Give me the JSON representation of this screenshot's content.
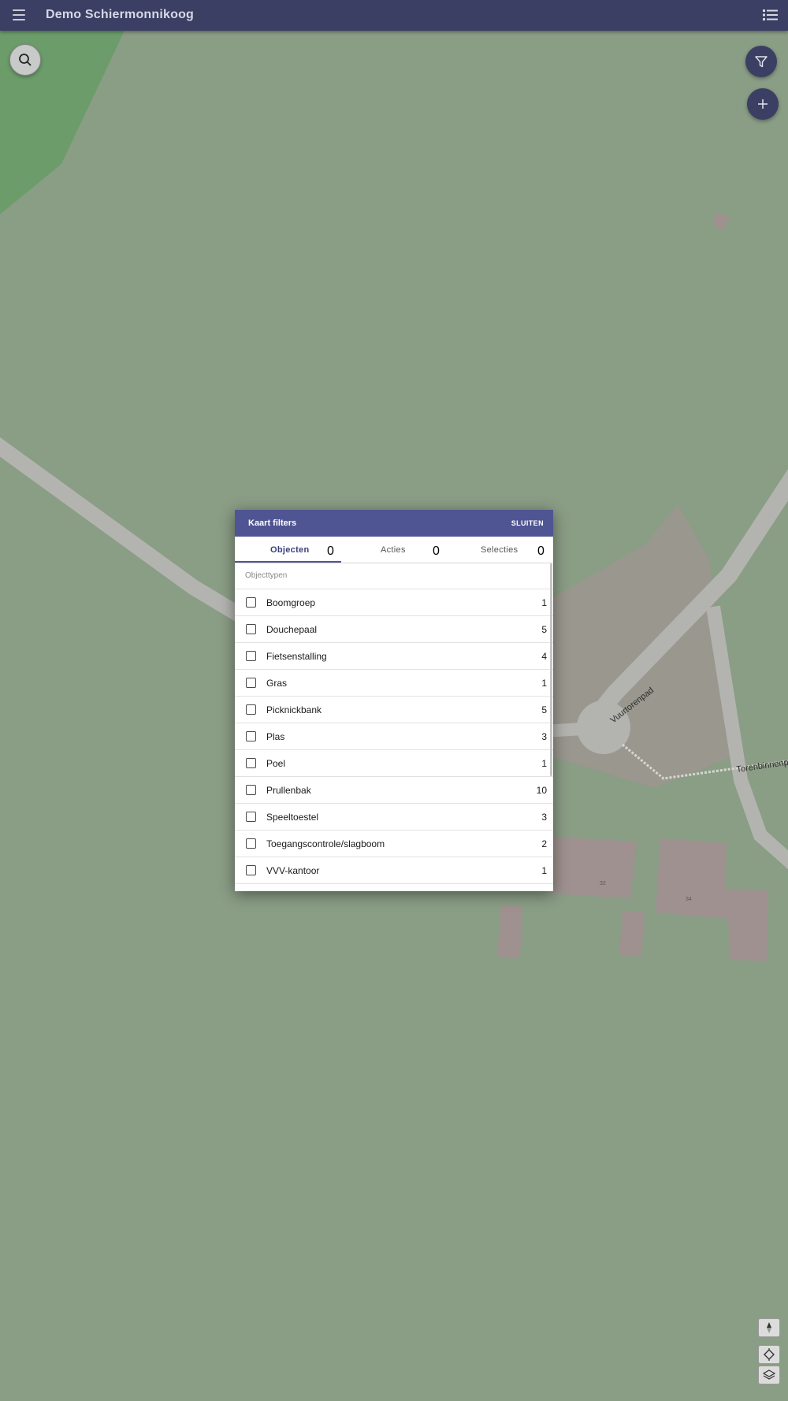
{
  "app": {
    "title": "Demo Schiermonnikoog"
  },
  "map": {
    "street_labels": [
      "Vuurtorenpad",
      "Torenbinnenpad"
    ],
    "house_numbers": [
      "32",
      "34"
    ]
  },
  "dialog": {
    "title": "Kaart filters",
    "close_label": "SLUITEN",
    "tabs": [
      {
        "label": "Objecten",
        "count": "0",
        "active": true
      },
      {
        "label": "Acties",
        "count": "0",
        "active": false
      },
      {
        "label": "Selecties",
        "count": "0",
        "active": false
      }
    ],
    "section_title": "Objecttypen",
    "items": [
      {
        "label": "Boomgroep",
        "count": "1"
      },
      {
        "label": "Douchepaal",
        "count": "5"
      },
      {
        "label": "Fietsenstalling",
        "count": "4"
      },
      {
        "label": "Gras",
        "count": "1"
      },
      {
        "label": "Picknickbank",
        "count": "5"
      },
      {
        "label": "Plas",
        "count": "3"
      },
      {
        "label": "Poel",
        "count": "1"
      },
      {
        "label": "Prullenbak",
        "count": "10"
      },
      {
        "label": "Speeltoestel",
        "count": "3"
      },
      {
        "label": "Toegangscontrole/slagboom",
        "count": "2"
      },
      {
        "label": "VVV-kantoor",
        "count": "1"
      },
      {
        "label": "",
        "count": ""
      }
    ]
  },
  "colors": {
    "topbar": "#3a3f63",
    "dialog_header": "#4f5592",
    "map_background": "#8a9d85",
    "forest": "#6c9c6a"
  },
  "icons": {
    "menu": "hamburger-icon",
    "list": "list-icon",
    "search": "search-icon",
    "filter": "filter-icon",
    "add": "plus-icon",
    "compass": "compass-icon",
    "locate": "locate-icon",
    "layers": "layers-icon"
  }
}
